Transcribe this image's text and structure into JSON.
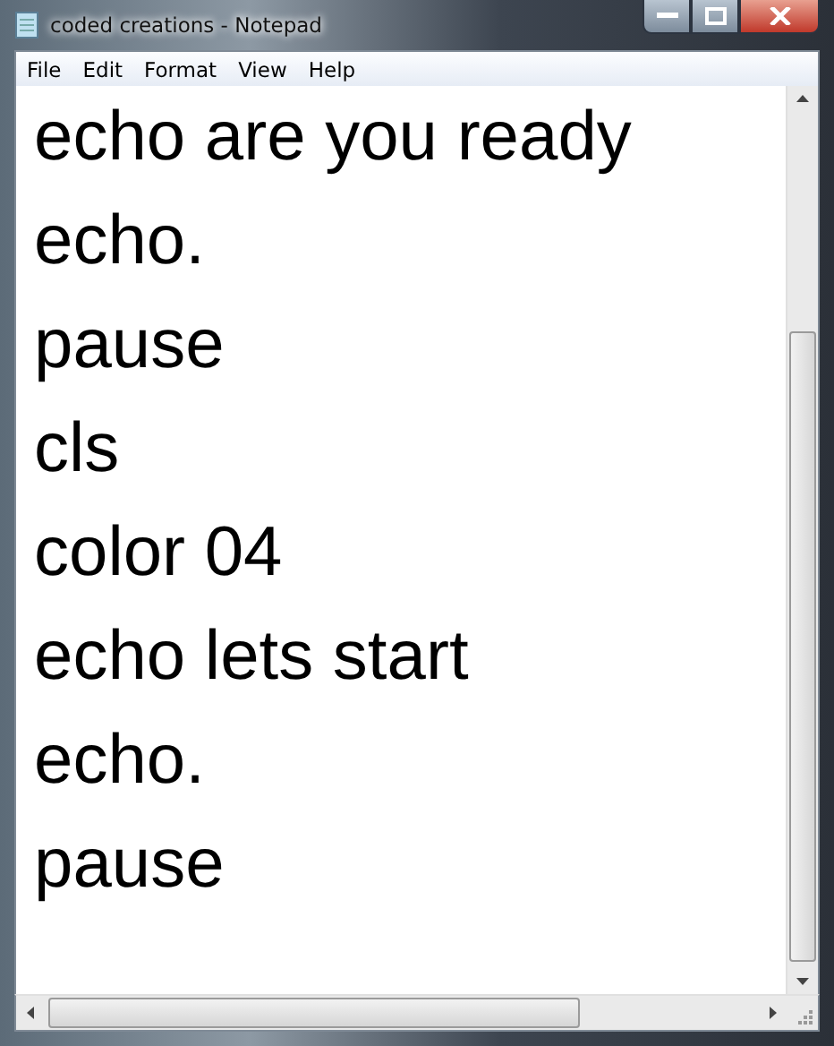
{
  "window": {
    "title": "coded creations - Notepad"
  },
  "menu": [
    "File",
    "Edit",
    "Format",
    "View",
    "Help"
  ],
  "lines": [
    "echo are you ready",
    "echo.",
    "pause",
    "cls",
    "color 04",
    "echo lets start",
    "echo.",
    "pause"
  ]
}
